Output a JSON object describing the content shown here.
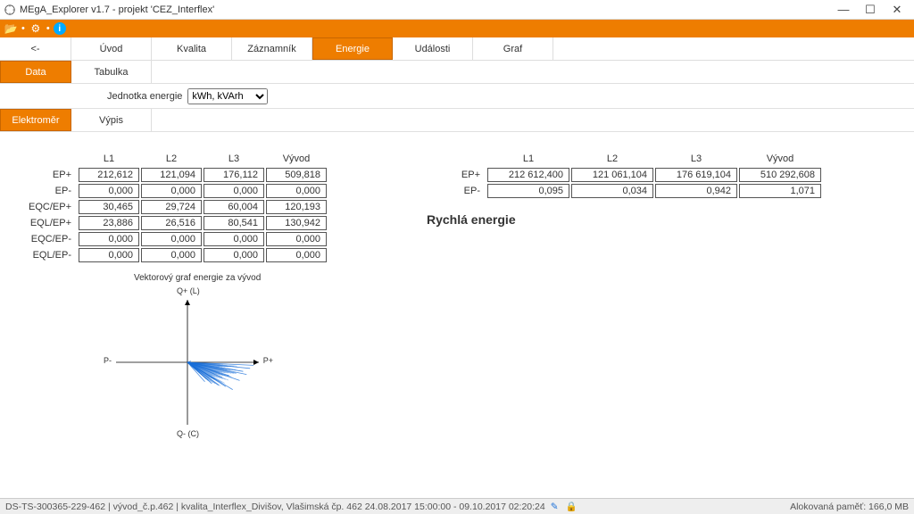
{
  "window": {
    "title": "MEgA_Explorer v1.7 - projekt 'CEZ_Interflex'",
    "minimize": "—",
    "maximize": "☐",
    "close": "✕"
  },
  "nav": {
    "back": "<-",
    "uvod": "Úvod",
    "kvalita": "Kvalita",
    "zaznamnik": "Záznamník",
    "energie": "Energie",
    "udalosti": "Události",
    "graf": "Graf",
    "data": "Data",
    "tabulka": "Tabulka",
    "elektromer": "Elektroměr",
    "vypis": "Výpis"
  },
  "unit": {
    "label": "Jednotka energie",
    "value": "kWh, kVArh"
  },
  "table_left": {
    "headers": {
      "c1": "L1",
      "c2": "L2",
      "c3": "L3",
      "c4": "Vývod"
    },
    "rows": [
      {
        "lbl": "EP+",
        "c1": "212,612",
        "c2": "121,094",
        "c3": "176,112",
        "c4": "509,818"
      },
      {
        "lbl": "EP-",
        "c1": "0,000",
        "c2": "0,000",
        "c3": "0,000",
        "c4": "0,000"
      },
      {
        "lbl": "EQC/EP+",
        "c1": "30,465",
        "c2": "29,724",
        "c3": "60,004",
        "c4": "120,193"
      },
      {
        "lbl": "EQL/EP+",
        "c1": "23,886",
        "c2": "26,516",
        "c3": "80,541",
        "c4": "130,942"
      },
      {
        "lbl": "EQC/EP-",
        "c1": "0,000",
        "c2": "0,000",
        "c3": "0,000",
        "c4": "0,000"
      },
      {
        "lbl": "EQL/EP-",
        "c1": "0,000",
        "c2": "0,000",
        "c3": "0,000",
        "c4": "0,000"
      }
    ]
  },
  "table_right": {
    "headers": {
      "c1": "L1",
      "c2": "L2",
      "c3": "L3",
      "c4": "Vývod"
    },
    "rows": [
      {
        "lbl": "EP+",
        "c1": "212 612,400",
        "c2": "121 061,104",
        "c3": "176 619,104",
        "c4": "510 292,608"
      },
      {
        "lbl": "EP-",
        "c1": "0,095",
        "c2": "0,034",
        "c3": "0,942",
        "c4": "1,071"
      }
    ],
    "quick_title": "Rychlá energie"
  },
  "vector": {
    "title": "Vektorový graf energie za vývod",
    "axis_top": "Q+ (L)",
    "axis_bottom": "Q- (C)",
    "axis_left": "P-",
    "axis_right": "P+",
    "color": "#1a6fd8"
  },
  "status": {
    "left": "DS-TS-300365-229-462 | vývod_č.p.462 | kvalita_Interflex_Divišov, Vlašimská čp. 462  24.08.2017 15:00:00 - 09.10.2017 02:20:24",
    "mem": "Alokovaná paměť: 166,0 MB"
  },
  "chart_data": {
    "type": "scatter",
    "title": "Vektorový graf energie za vývod",
    "xlabel": "P",
    "ylabel": "Q",
    "xlim": [
      -1,
      1
    ],
    "ylim": [
      -1,
      1
    ],
    "note": "Polar vector plot of energy per output; vectors cluster in 4th quadrant (P+, Q-)",
    "series": [
      {
        "name": "vektory",
        "x": [
          0.05,
          0.95,
          0.9,
          0.8,
          0.7,
          0.6,
          0.5,
          0.4,
          0.3,
          0.2,
          0.35,
          0.55,
          0.75,
          0.85,
          0.65,
          0.45,
          0.25,
          0.15
        ],
        "y": [
          0.02,
          -0.05,
          -0.1,
          -0.15,
          -0.18,
          -0.22,
          -0.25,
          -0.28,
          -0.3,
          -0.2,
          -0.35,
          -0.4,
          -0.3,
          -0.2,
          -0.45,
          -0.38,
          -0.32,
          -0.12
        ]
      }
    ]
  }
}
